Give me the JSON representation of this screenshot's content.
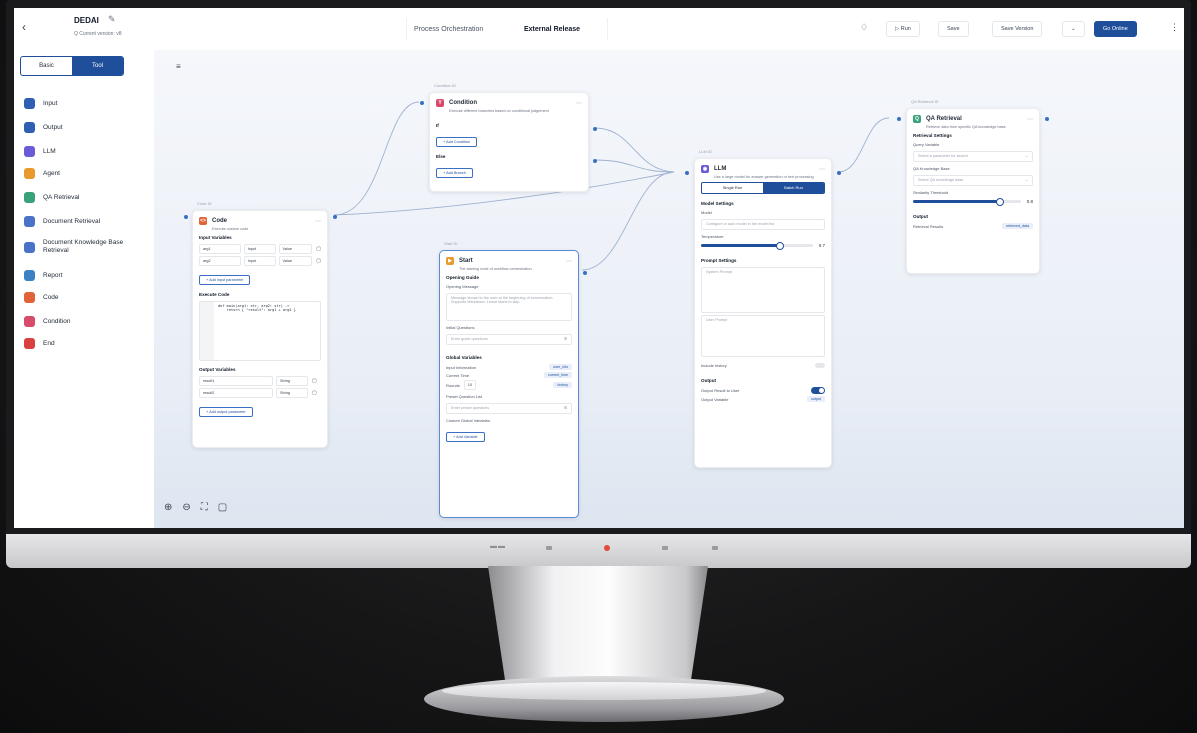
{
  "topbar": {
    "back_icon": "chevron-left-icon",
    "title": "DEDAI",
    "subtitle": "Q Current version: v8",
    "tabs": [
      "Process Orchestration",
      "External Release"
    ],
    "run": "Run",
    "save": "Save",
    "save_version": "Save Version",
    "go_online": "Go Online"
  },
  "sidebar": {
    "segment": [
      "Basic",
      "Tool"
    ],
    "items": [
      {
        "label": "Input",
        "icon": "input-icon",
        "color": "#2f5fb3"
      },
      {
        "label": "Output",
        "icon": "output-icon",
        "color": "#2f5fb3"
      },
      {
        "label": "LLM",
        "icon": "llm-icon",
        "color": "#6b5bd6"
      },
      {
        "label": "Agent",
        "icon": "agent-icon",
        "color": "#e89b2c"
      },
      {
        "label": "QA Retrieval",
        "icon": "qa-icon",
        "color": "#3aa27a"
      },
      {
        "label": "Document Retrieval",
        "icon": "document-icon",
        "color": "#4a73c8"
      },
      {
        "label": "Document Knowledge Base Retrieval",
        "icon": "kb-icon",
        "color": "#4a73c8"
      },
      {
        "label": "Report",
        "icon": "report-icon",
        "color": "#3b82c4"
      },
      {
        "label": "Code",
        "icon": "code-icon",
        "color": "#e0633a"
      },
      {
        "label": "Condition",
        "icon": "condition-icon",
        "color": "#d94b6a"
      },
      {
        "label": "End",
        "icon": "end-icon",
        "color": "#d94040"
      }
    ]
  },
  "code_node": {
    "id": "Code ID",
    "title": "Code",
    "desc": "Execute custom code",
    "input_label": "Input Variables",
    "inputs": [
      {
        "name": "arg1",
        "type": "Input",
        "value": "Value"
      },
      {
        "name": "arg2",
        "type": "Input",
        "value": "Value"
      }
    ],
    "add_input": "+ Add input parameter",
    "code_label": "Execute Code",
    "code": "def main(arg1: str, arg2: str) ->\n    return { \"result\": arg1 + arg2 }",
    "output_label": "Output Variables",
    "outputs": [
      {
        "name": "result1",
        "type": "String"
      },
      {
        "name": "result2",
        "type": "String"
      }
    ],
    "add_output": "+ Add output parameter"
  },
  "condition_node": {
    "id": "Condition ID",
    "title": "Condition",
    "desc": "Execute different branches based on conditional judgement",
    "if": "If",
    "add_condition": "+ Add Condition",
    "else": "Else",
    "add_branch": "+ Add Branch"
  },
  "start_node": {
    "id": "Start ID",
    "title": "Start",
    "desc": "The starting node of workflow orchestration",
    "opening_label": "Opening Guide",
    "opening_msg_label": "Opening Message",
    "opening_msg": "Message shown to the user at the beginning of conversation. Supports Markdown. Leave blank to skip.",
    "suggest_label": "Initial Questions",
    "suggest_placeholder": "Enter guide questions",
    "global_label": "Global Variables",
    "globals": [
      {
        "label": "Input Information",
        "tag": "user_info"
      },
      {
        "label": "Current Time",
        "tag": "current_time"
      },
      {
        "label": "Rounds",
        "value": "10",
        "tag": "history"
      }
    ],
    "preset_label": "Preset Question List",
    "preset_placeholder": "Enter preset questions",
    "custom_label": "Custom Global Variables",
    "add_variable": "+ Add Variable"
  },
  "llm_node": {
    "id": "LLM ID",
    "title": "LLM",
    "desc": "Use a large model for answer generation or text processing",
    "mode": [
      "Single Run",
      "Batch Run"
    ],
    "model_label": "Model Settings",
    "model_sub": "Model",
    "model_value": "Configure or auto model in the model list",
    "temp_label": "Temperature",
    "temp_value": "0.7",
    "temp_fraction": 0.7,
    "prompt_label": "Prompt Settings",
    "system_prompt": "System Prompt",
    "user_prompt": "User Prompt",
    "history_label": "Include history",
    "output_label": "Output",
    "output_toggle": "Output Result to User",
    "output_var": "Output Variable",
    "output_tag": "output"
  },
  "qa_node": {
    "id": "QA Retrieval ID",
    "title": "QA Retrieval",
    "desc": "Retrieve data from specific QA knowledge base",
    "settings_label": "Retrieval Settings",
    "query_label": "Query Variable",
    "query_placeholder": "Select a parameter for search",
    "kb_label": "QA Knowledge Base",
    "kb_placeholder": "Select QA knowledge base",
    "sim_label": "Similarity Threshold",
    "sim_value": "0.8",
    "sim_fraction": 0.8,
    "output_label": "Output",
    "output_name": "Retrieval Results",
    "output_tag": "retrieved_data"
  },
  "zoom": [
    "zoom-in-icon",
    "zoom-out-icon",
    "fit-view-icon",
    "minimap-icon"
  ]
}
